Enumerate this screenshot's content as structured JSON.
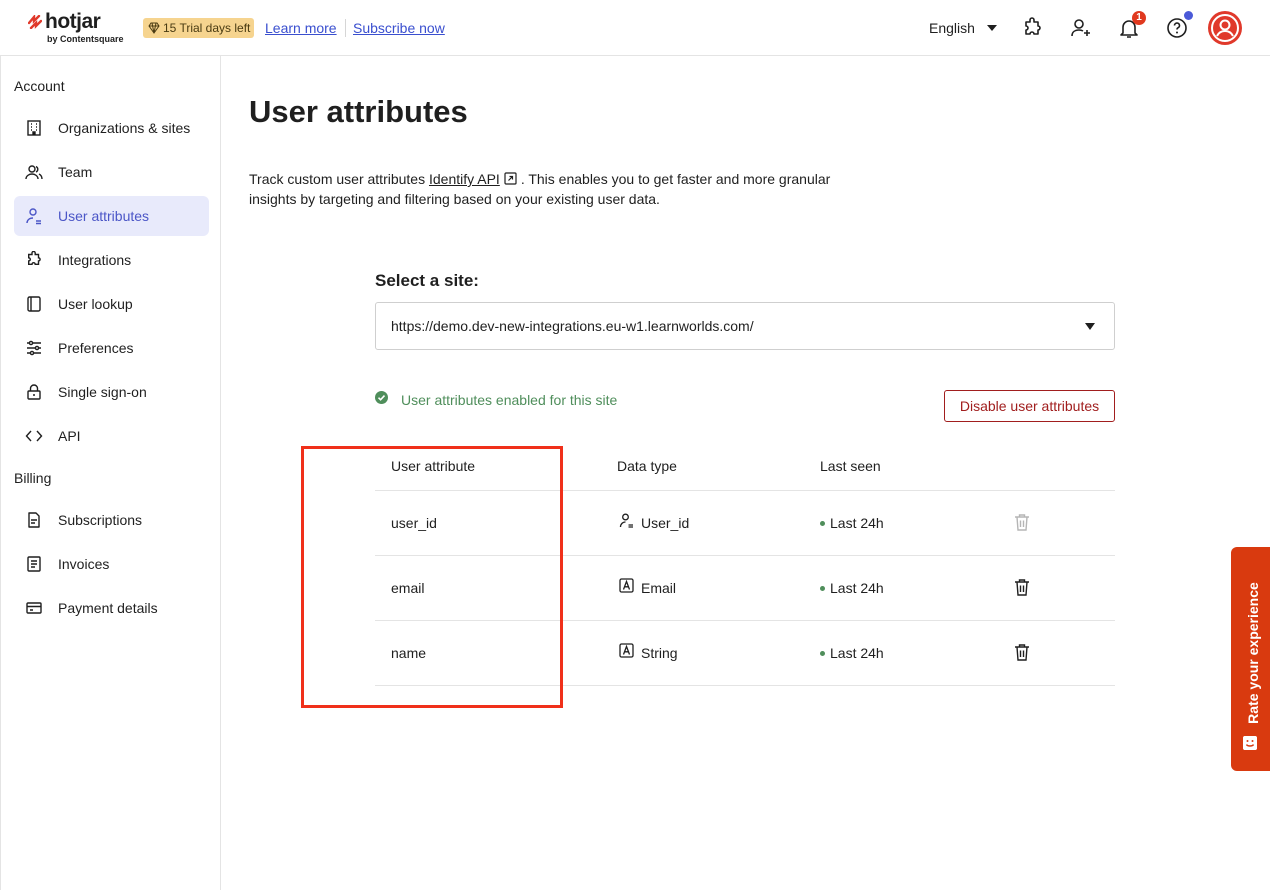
{
  "header": {
    "logo_word": "hotjar",
    "logo_sub": "by Contentsquare",
    "trial_badge": "15 Trial days left",
    "learn_more": "Learn more",
    "subscribe": "Subscribe now",
    "language": "English",
    "notification_count": "1"
  },
  "sidebar": {
    "section_account": "Account",
    "section_billing": "Billing",
    "items": [
      {
        "label": "Organizations & sites",
        "icon": "building-icon"
      },
      {
        "label": "Team",
        "icon": "team-icon"
      },
      {
        "label": "User attributes",
        "icon": "user-attributes-icon",
        "active": true
      },
      {
        "label": "Integrations",
        "icon": "puzzle-icon"
      },
      {
        "label": "User lookup",
        "icon": "user-lookup-icon"
      },
      {
        "label": "Preferences",
        "icon": "sliders-icon"
      },
      {
        "label": "Single sign-on",
        "icon": "lock-icon"
      },
      {
        "label": "API",
        "icon": "code-icon"
      }
    ],
    "billing_items": [
      {
        "label": "Subscriptions",
        "icon": "subscriptions-icon"
      },
      {
        "label": "Invoices",
        "icon": "invoice-icon"
      },
      {
        "label": "Payment details",
        "icon": "card-icon"
      }
    ]
  },
  "main": {
    "title": "User attributes",
    "intro_pre": "Track custom user attributes ",
    "intro_link": "Identify API",
    "intro_post": ". This enables you to get faster and more granular insights by targeting and filtering based on your existing user data.",
    "select_label": "Select a site:",
    "selected_site": "https://demo.dev-new-integrations.eu-w1.learnworlds.com/",
    "status": "User attributes enabled for this site",
    "disable_button": "Disable user attributes",
    "table": {
      "headers": [
        "User attribute",
        "Data type",
        "Last seen"
      ],
      "rows": [
        {
          "attribute": "user_id",
          "type": "User_id",
          "last_seen": "Last 24h"
        },
        {
          "attribute": "email",
          "type": "Email",
          "last_seen": "Last 24h"
        },
        {
          "attribute": "name",
          "type": "String",
          "last_seen": "Last 24h"
        }
      ]
    }
  },
  "rate_tab": "Rate your experience",
  "colors": {
    "accent": "#4b56c7",
    "brand": "#e0392b",
    "danger": "#a11e1e",
    "success": "#4f8e5b",
    "highlight": "#f0301a",
    "rate_tab": "#d93a0f"
  }
}
